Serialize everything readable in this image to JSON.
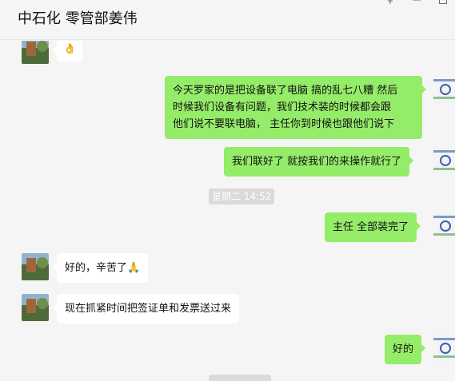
{
  "window": {
    "title": "中石化 零管部姜伟",
    "controls": {
      "pin": "pin-icon",
      "minimize": "minimize-icon",
      "maximize": "maximize-icon"
    }
  },
  "messages": [
    {
      "from": "contact",
      "type": "emoji",
      "text": "👌"
    },
    {
      "from": "me",
      "lines": [
        "今天罗家的是把设备联了电脑 搞的乱七八糟 然后",
        "时候我们设备有问题，我们技术装的时候都会跟",
        "他们说不要联电脑， 主任你到时候也跟他们说下"
      ]
    },
    {
      "from": "me",
      "text": "我们联好了 就按我们的来操作就行了"
    },
    {
      "type": "time",
      "text": "星期二 14:52"
    },
    {
      "from": "me",
      "text": "主任 全部装完了"
    },
    {
      "from": "contact",
      "text": "好的，辛苦了🙏"
    },
    {
      "from": "contact",
      "text": "现在抓紧时间把签证单和发票送过来"
    },
    {
      "from": "me",
      "text": "好的"
    }
  ],
  "colors": {
    "outgoing_bubble": "#95ec69",
    "incoming_bubble": "#ffffff",
    "background": "#f5f5f5"
  }
}
